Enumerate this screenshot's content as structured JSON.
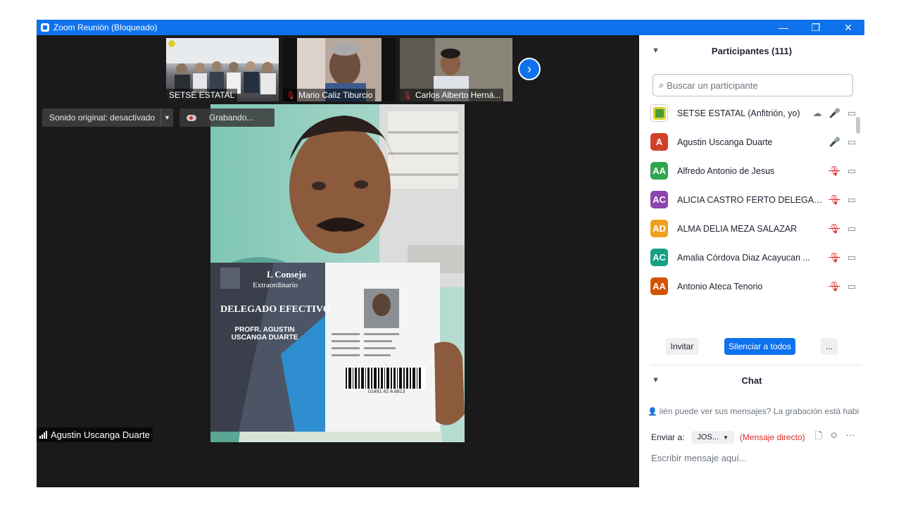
{
  "window": {
    "title": "Zoom Reunión (Bloqueado)",
    "controls": {
      "minimize": "—",
      "restore": "❐",
      "close": "✕"
    }
  },
  "gallery": {
    "tiles": [
      {
        "name": "SETSE ESTATAL",
        "muted": false
      },
      {
        "name": "Mario Caliz Tiburcio",
        "muted": true
      },
      {
        "name": "Carlos Alberto Herná...",
        "muted": true
      }
    ],
    "next_icon": "›"
  },
  "toolbar": {
    "original_sound": "Sonido original: desactivado",
    "recording": "Grabando..."
  },
  "active_speaker": {
    "name": "Agustin Uscanga Duarte",
    "card": {
      "line1": "L Consejo",
      "line2": "Extraordinario",
      "title": "DELEGADO EFECTIVO",
      "person": "PROFR. AGUSTIN USCANGA DUARTE",
      "barcode": "01491.42 A 8813"
    }
  },
  "participants": {
    "header": "Participantes (111)",
    "search_placeholder": "Buscar un participante",
    "list": [
      {
        "initials": "",
        "name": "SETSE ESTATAL (Anfitrión, yo)",
        "color": "#d8d030",
        "mic": "on",
        "logo": true
      },
      {
        "initials": "A",
        "name": "Agustin Uscanga Duarte",
        "color": "#d0412a",
        "mic": "on"
      },
      {
        "initials": "AA",
        "name": "Alfredo Antonio de Jesus",
        "color": "#2ea84e",
        "mic": "off"
      },
      {
        "initials": "AC",
        "name": "ALICIA CASTRO FERTO DELEGAC...",
        "color": "#8e44ad",
        "mic": "off"
      },
      {
        "initials": "AD",
        "name": "ALMA DELIA MEZA SALAZAR",
        "color": "#f0a020",
        "mic": "off"
      },
      {
        "initials": "AC",
        "name": "Amalia Córdova Diaz Acayucan ...",
        "color": "#16a085",
        "mic": "off"
      },
      {
        "initials": "AA",
        "name": "Antonio Ateca Tenorio",
        "color": "#d35400",
        "mic": "off"
      }
    ],
    "invite": "Invitar",
    "mute_all": "Silenciar a todos",
    "more": "..."
  },
  "chat": {
    "header": "Chat",
    "notice": "iién puede ver sus mensajes? La grabación está habilit",
    "send_to_label": "Enviar a:",
    "recipient": "JOS...",
    "direct": "(Mensaje directo)",
    "placeholder": "Escribir mensaje aquí..."
  }
}
